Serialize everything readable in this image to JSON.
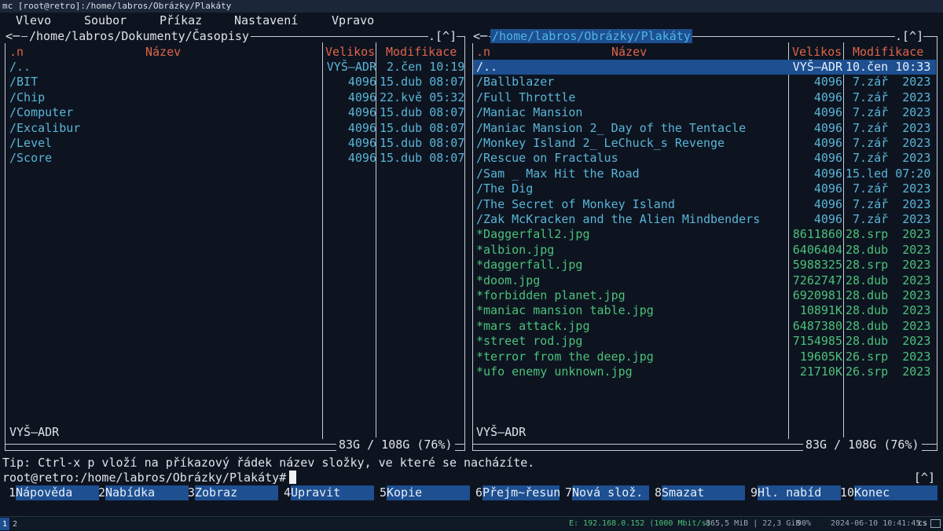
{
  "window": {
    "title": "mc [root@retro]:/home/labros/Obrázky/Plakáty"
  },
  "menu": [
    "Vlevo",
    "Soubor",
    "Příkaz",
    "Nastavení",
    "Vpravo"
  ],
  "left_panel": {
    "path": "/home/labros/Dokumenty/Časopisy",
    "arrow": "<─",
    "controls": ".[^]",
    "headers": {
      "sort": ".n",
      "name": "Název",
      "size": "Velikos",
      "mtime": "Modifikace"
    },
    "rows": [
      {
        "name": "/..",
        "size": "VYŠ–ADR",
        "date": " 2.čen 10:19",
        "type": "up"
      },
      {
        "name": "/BIT",
        "size": "4096",
        "date": "15.dub 08:07",
        "type": "dir"
      },
      {
        "name": "/Chip",
        "size": "4096",
        "date": "22.kvě 05:32",
        "type": "dir"
      },
      {
        "name": "/Computer",
        "size": "4096",
        "date": "15.dub 08:07",
        "type": "dir"
      },
      {
        "name": "/Excalibur",
        "size": "4096",
        "date": "15.dub 08:07",
        "type": "dir"
      },
      {
        "name": "/Level",
        "size": "4096",
        "date": "15.dub 08:07",
        "type": "dir"
      },
      {
        "name": "/Score",
        "size": "4096",
        "date": "15.dub 08:07",
        "type": "dir"
      }
    ],
    "status": "VYŠ–ADR",
    "disk": "83G / 108G (76%)"
  },
  "right_panel": {
    "path": "/home/labros/Obrázky/Plakáty",
    "arrow": "<─",
    "controls": ".[^]",
    "headers": {
      "sort": ".n",
      "name": "Název",
      "size": "Velikos",
      "mtime": "Modifikace"
    },
    "rows": [
      {
        "name": "/..",
        "size": "VYŠ–ADR",
        "date": "10.čen 10:33",
        "type": "sel"
      },
      {
        "name": "/Ballblazer",
        "size": "4096",
        "date": " 7.zář  2023",
        "type": "dir"
      },
      {
        "name": "/Full Throttle",
        "size": "4096",
        "date": " 7.zář  2023",
        "type": "dir"
      },
      {
        "name": "/Maniac Mansion",
        "size": "4096",
        "date": " 7.zář  2023",
        "type": "dir"
      },
      {
        "name": "/Maniac Mansion 2_ Day of the Tentacle",
        "size": "4096",
        "date": " 7.zář  2023",
        "type": "dir"
      },
      {
        "name": "/Monkey Island 2_ LeChuck_s Revenge",
        "size": "4096",
        "date": " 7.zář  2023",
        "type": "dir"
      },
      {
        "name": "/Rescue on Fractalus",
        "size": "4096",
        "date": " 7.zář  2023",
        "type": "dir"
      },
      {
        "name": "/Sam _ Max Hit the Road",
        "size": "4096",
        "date": "15.led 07:20",
        "type": "dir"
      },
      {
        "name": "/The Dig",
        "size": "4096",
        "date": " 7.zář  2023",
        "type": "dir"
      },
      {
        "name": "/The Secret of Monkey Island",
        "size": "4096",
        "date": " 7.zář  2023",
        "type": "dir"
      },
      {
        "name": "/Zak McKracken and the Alien Mindbenders",
        "size": "4096",
        "date": " 7.zář  2023",
        "type": "dir"
      },
      {
        "name": "*Daggerfall2.jpg",
        "size": "8611860",
        "date": "28.srp  2023",
        "type": "exe"
      },
      {
        "name": "*albion.jpg",
        "size": "6406404",
        "date": "28.dub  2023",
        "type": "exe"
      },
      {
        "name": "*daggerfall.jpg",
        "size": "5988325",
        "date": "28.srp  2023",
        "type": "exe"
      },
      {
        "name": "*doom.jpg",
        "size": "7262747",
        "date": "28.dub  2023",
        "type": "exe"
      },
      {
        "name": "*forbidden planet.jpg",
        "size": "6920981",
        "date": "28.dub  2023",
        "type": "exe"
      },
      {
        "name": "*maniac mansion table.jpg",
        "size": "10891K",
        "date": "28.dub  2023",
        "type": "exe"
      },
      {
        "name": "*mars attack.jpg",
        "size": "6487380",
        "date": "28.dub  2023",
        "type": "exe"
      },
      {
        "name": "*street rod.jpg",
        "size": "7154985",
        "date": "28.dub  2023",
        "type": "exe"
      },
      {
        "name": "*terror from the deep.jpg",
        "size": "19605K",
        "date": "26.srp  2023",
        "type": "exe"
      },
      {
        "name": "*ufo enemy unknown.jpg",
        "size": "21710K",
        "date": "26.srp  2023",
        "type": "exe"
      }
    ],
    "status": "VYŠ–ADR",
    "disk": "83G / 108G (76%)"
  },
  "tip": "Tip: Ctrl-x p vloží na příkazový řádek název složky, ve které se nacházíte.",
  "prompt": "root@retro:/home/labros/Obrázky/Plakáty#",
  "history_marker": "[^]",
  "fkeys": [
    {
      "num": "1",
      "label": "Nápověda"
    },
    {
      "num": "2",
      "label": "Nabídka"
    },
    {
      "num": "3",
      "label": "Zobraz"
    },
    {
      "num": "4",
      "label": "Upravit"
    },
    {
      "num": "5",
      "label": "Kopie"
    },
    {
      "num": "6",
      "label": "Přejm~řesun"
    },
    {
      "num": "7",
      "label": "Nová slož."
    },
    {
      "num": "8",
      "label": "Smazat"
    },
    {
      "num": "9",
      "label": "Hl. nabíd"
    },
    {
      "num": "10",
      "label": "Konec"
    }
  ],
  "statusbar": {
    "workspaces": [
      "1",
      "2"
    ],
    "network": "E: 192.168.0.152 (1000 Mbit/s)",
    "memory": "865,5 MiB | 22,3 GiB",
    "disk": "90%",
    "datetime": "2024-06-10 10:41:45",
    "layout": "cs",
    "colors": {
      "network": "#4cc07a"
    }
  }
}
